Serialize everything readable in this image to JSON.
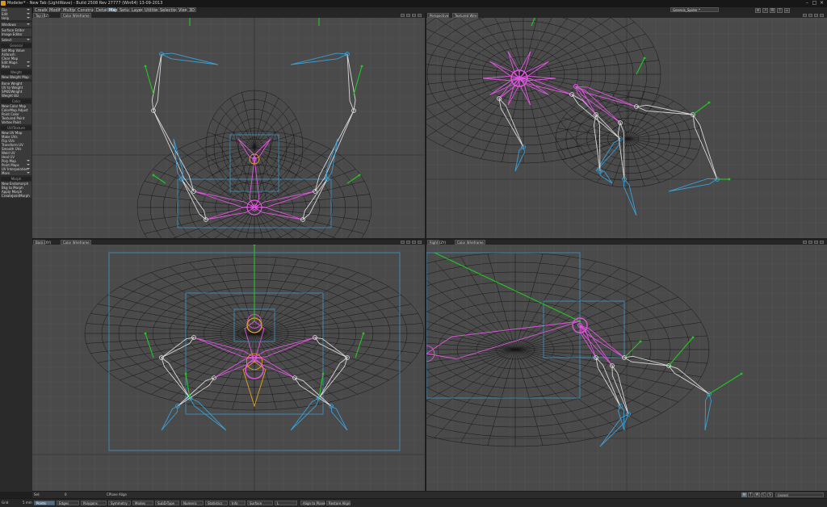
{
  "window": {
    "title": "Modeler* - New Tab (LightWave) - Build 2508 Rev 27777 (Win64) 13-09-2013",
    "logo": "LW"
  },
  "menu_tabs": [
    "Create",
    "Modify",
    "Multiply",
    "Construct",
    "Detail",
    "Map",
    "Setup",
    "Layers",
    "Utilities",
    "Selection",
    "View",
    "3D"
  ],
  "active_tab": "Map",
  "top_right": {
    "object": "Genesis_Spider *"
  },
  "left_panel": {
    "file": "File",
    "edit": "Edit",
    "help": "Help",
    "windows": "Windows",
    "surface_editor": "Surface Editor",
    "image_editor": "Image Editor",
    "select": "Select",
    "general_header": "General",
    "general": [
      "Set Map Value",
      "Airbrush",
      "Clear Map",
      "Edit Maps",
      "More"
    ],
    "weight_header": "Weight",
    "weight": [
      "New Weight Map",
      "Bone Weight",
      "UV to Weight",
      "SPW2Weight",
      "Weight Biz"
    ],
    "color_header": "Color",
    "color": [
      "New Color Map",
      "ColorMap Adjust",
      "Point Color",
      "Textured Point",
      "Vertex Paint"
    ],
    "uv_header": "UV/Texture",
    "uv": [
      "New UV Map",
      "Make UVs",
      "Flip UVs",
      "Transform UV",
      "Smooth UVs",
      "Weld UV",
      "Heal UV",
      "Poly Map",
      "Point Maps",
      "UV Interpolation",
      "More"
    ],
    "morph_header": "Morph",
    "morph": [
      "New Endomorph",
      "Bkg to Morph",
      "Apply Morph",
      "CreateJointMorph"
    ]
  },
  "viewports": [
    {
      "name": "Top (XZ)",
      "mode": "Color Wireframe"
    },
    {
      "name": "Perspective",
      "mode": "Textured Wire"
    },
    {
      "name": "Back (XY)",
      "mode": "Color Wireframe"
    },
    {
      "name": "Right (ZY)",
      "mode": "Color Wireframe"
    }
  ],
  "status": {
    "sel_label": "Sel:",
    "sel_value": "0",
    "hint": "CPlane Align"
  },
  "status_right": {
    "flags": [
      "M",
      "T",
      "W",
      "C",
      "S"
    ],
    "value": "(none)"
  },
  "bottom": {
    "grid_label": "Grid",
    "grid_value": "5 mm",
    "modes": [
      "Points",
      "Edges",
      "Polygons",
      "Symmetry",
      "Modes",
      "SubD-Type",
      "Numeric",
      "Statistics",
      "Info",
      "Surface"
    ],
    "active_mode": "Points",
    "surface_value": "L",
    "actions": [
      "Align to Plane",
      "Restore Align"
    ]
  },
  "colors": {
    "viewport_bg": "#4a4a4a",
    "grid": "#555555",
    "wire": "#0d0d0d",
    "bone_pink": "#e056e0",
    "bone_blue": "#3aa0d8",
    "bone_white": "#d8d8d8",
    "bone_orange": "#e8a020",
    "handle_green": "#22c822",
    "accent": "#4f6f90"
  },
  "icons": [
    "lightwave-logo-icon",
    "minimize-icon",
    "maximize-icon",
    "close-icon",
    "move-view-icon",
    "rotate-view-icon",
    "zoom-view-icon",
    "maximize-view-icon",
    "dropdown-arrow-icon"
  ]
}
